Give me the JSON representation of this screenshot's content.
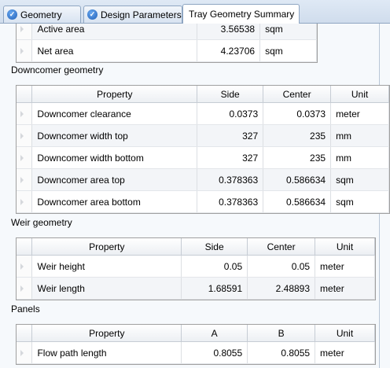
{
  "tabs": [
    {
      "label": "Geometry",
      "icon": "check-icon",
      "active": false
    },
    {
      "label": "Design Parameters",
      "icon": "check-icon",
      "active": false
    },
    {
      "label": "Tray Geometry Summary",
      "icon": "",
      "active": true
    }
  ],
  "area_grid": {
    "rows": [
      {
        "property": "Active area",
        "value": "3.56538",
        "unit": "sqm"
      },
      {
        "property": "Net area",
        "value": "4.23706",
        "unit": "sqm"
      }
    ]
  },
  "downcomer": {
    "title": "Downcomer geometry",
    "headers": [
      "Property",
      "Side",
      "Center",
      "Unit"
    ],
    "rows": [
      {
        "property": "Downcomer clearance",
        "side": "0.0373",
        "center": "0.0373",
        "unit": "meter"
      },
      {
        "property": "Downcomer width top",
        "side": "327",
        "center": "235",
        "unit": "mm"
      },
      {
        "property": "Downcomer width bottom",
        "side": "327",
        "center": "235",
        "unit": "mm"
      },
      {
        "property": "Downcomer area top",
        "side": "0.378363",
        "center": "0.586634",
        "unit": "sqm"
      },
      {
        "property": "Downcomer area bottom",
        "side": "0.378363",
        "center": "0.586634",
        "unit": "sqm"
      }
    ]
  },
  "weir": {
    "title": "Weir geometry",
    "headers": [
      "Property",
      "Side",
      "Center",
      "Unit"
    ],
    "rows": [
      {
        "property": "Weir height",
        "side": "0.05",
        "center": "0.05",
        "unit": "meter"
      },
      {
        "property": "Weir length",
        "side": "1.68591",
        "center": "2.48893",
        "unit": "meter"
      }
    ]
  },
  "panels": {
    "title": "Panels",
    "headers": [
      "Property",
      "A",
      "B",
      "Unit"
    ],
    "rows": [
      {
        "property": "Flow path length",
        "a": "0.8055",
        "b": "0.8055",
        "unit": "meter"
      }
    ]
  }
}
